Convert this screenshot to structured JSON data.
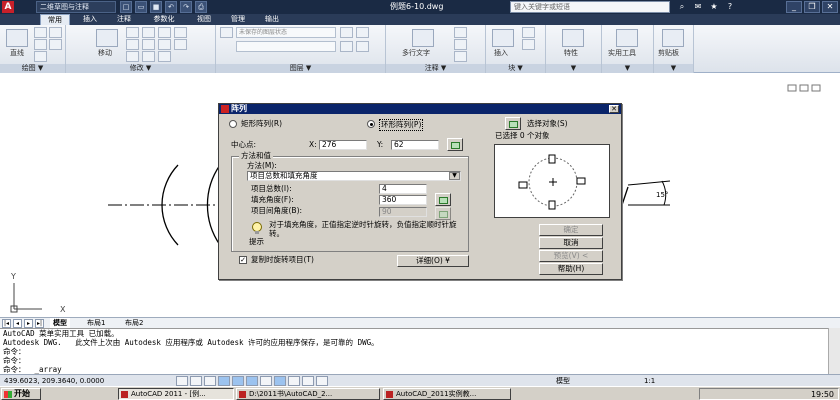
{
  "titlebar": {
    "workspace": "二维草图与注释",
    "document": "例题6-10.dwg",
    "search_placeholder": "键入关键字或短语"
  },
  "ribbon_tabs": [
    "常用",
    "插入",
    "注释",
    "参数化",
    "视图",
    "管理",
    "输出"
  ],
  "ribbon": {
    "draw_line": "直线",
    "modify_move": "移动",
    "layer_state": "未保存的图层状态",
    "multiline_text": "多行文字",
    "insert": "插入",
    "properties": "特性",
    "utilities": "实用工具",
    "clipboard": "剪贴板",
    "panels": [
      "绘图 ▼",
      "修改 ▼",
      "图层 ▼",
      "注释 ▼",
      "块 ▼"
    ]
  },
  "drawing": {
    "dim_text": "15°",
    "ucs_x": "X",
    "ucs_y": "Y"
  },
  "layout_tabs": [
    "模型",
    "布局1",
    "布局2"
  ],
  "command_lines": [
    "AutoCAD 菜单实用工具 已加载。",
    "Autodesk DWG.   此文件上次由 Autodesk 应用程序或 Autodesk 许可的应用程序保存，是可靠的 DWG。",
    "命令：",
    "命令：",
    "命令：  _array"
  ],
  "status": {
    "coords": "439.6023, 209.3640, 0.0000",
    "model": "模型",
    "scale": "1:1"
  },
  "taskbar": {
    "start": "开始",
    "tasks": [
      "AutoCAD 2011 - [例...",
      "D:\\2011书\\AutoCAD_2...",
      "AutoCAD_2011实例教..."
    ],
    "clock": "19:50"
  },
  "dialog": {
    "title": "阵列",
    "rect_array": "矩形阵列(R)",
    "polar_array": "环形阵列(P)",
    "select_objects": "选择对象(S)",
    "selected_count": "已选择 0 个对象",
    "center_label": "中心点:",
    "x_label": "X:",
    "x_value": "276",
    "y_label": "Y:",
    "y_value": "62",
    "method_group": "方法和值",
    "method_label": "方法(M):",
    "method_value": "项目总数和填充角度",
    "items_label": "项目总数(I):",
    "items_value": "4",
    "fill_label": "填充角度(F):",
    "fill_value": "360",
    "between_label": "项目间角度(B):",
    "between_value": "90",
    "tip_text": "对于填充角度，正值指定逆时针旋转，负值指定顺时针旋转。",
    "tip_label": "提示",
    "rotate_label": "复制时旋转项目(T)",
    "more_label": "详细(O)",
    "ok": "确定",
    "cancel": "取消",
    "preview": "预览(V) <",
    "help": "帮助(H)"
  }
}
